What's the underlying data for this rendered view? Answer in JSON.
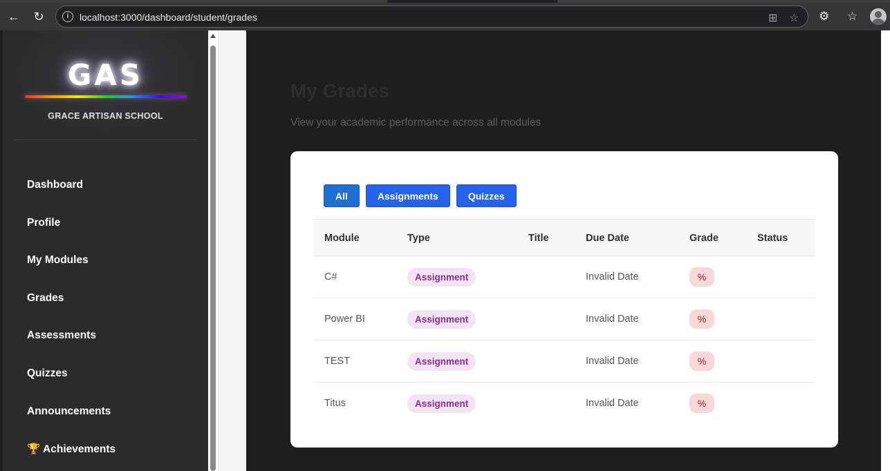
{
  "browser": {
    "url": "localhost:3000/dashboard/student/grades"
  },
  "sidebar": {
    "logo": "GAS",
    "school_name": "GRACE ARTISAN SCHOOL",
    "items": [
      {
        "label": "Dashboard"
      },
      {
        "label": "Profile"
      },
      {
        "label": "My Modules"
      },
      {
        "label": "Grades"
      },
      {
        "label": "Assessments"
      },
      {
        "label": "Quizzes"
      },
      {
        "label": "Announcements"
      },
      {
        "label": "🏆 Achievements"
      }
    ]
  },
  "main": {
    "title": "My Grades",
    "subtitle": "View your academic performance across all modules",
    "filters": [
      "All",
      "Assignments",
      "Quizzes"
    ],
    "active_filter": "All",
    "columns": [
      "Module",
      "Type",
      "Title",
      "Due Date",
      "Grade",
      "Status"
    ],
    "rows": [
      {
        "module": "C#",
        "type": "Assignment",
        "title": "",
        "due": "Invalid Date",
        "grade": "%",
        "status": ""
      },
      {
        "module": "Power BI",
        "type": "Assignment",
        "title": "",
        "due": "Invalid Date",
        "grade": "%",
        "status": ""
      },
      {
        "module": "TEST",
        "type": "Assignment",
        "title": "",
        "due": "Invalid Date",
        "grade": "%",
        "status": ""
      },
      {
        "module": "Titus",
        "type": "Assignment",
        "title": "",
        "due": "Invalid Date",
        "grade": "%",
        "status": ""
      }
    ]
  },
  "colors": {
    "primary": "#2563eb",
    "sidebar_bg": "#2b2b2b",
    "main_bg": "#1e1e1e",
    "type_badge_bg": "#f3e4f4",
    "type_badge_text": "#8a2b93",
    "grade_badge_bg": "#f8d7d9"
  }
}
